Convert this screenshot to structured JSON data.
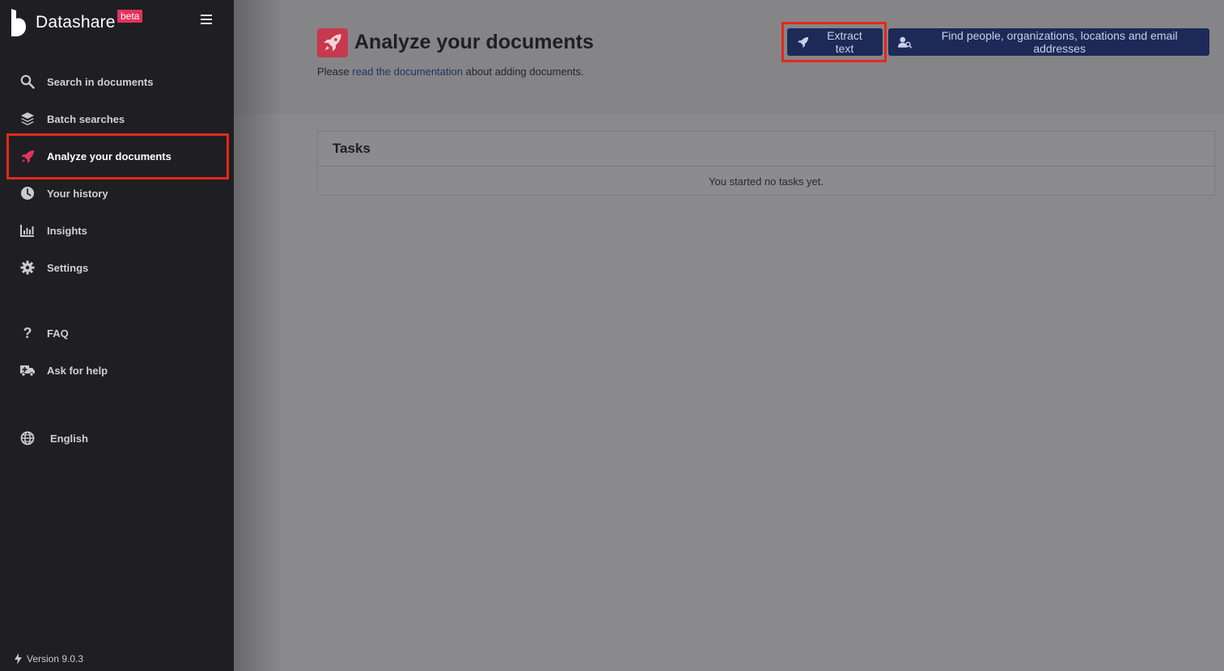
{
  "sidebar": {
    "brand_name": "Datashare",
    "brand_badge": "beta",
    "items": [
      {
        "label": "Search in documents",
        "icon": "search-icon"
      },
      {
        "label": "Batch searches",
        "icon": "layers-icon"
      },
      {
        "label": "Analyze your documents",
        "icon": "rocket-icon",
        "active": true
      },
      {
        "label": "Your history",
        "icon": "clock-icon"
      },
      {
        "label": "Insights",
        "icon": "chart-icon"
      },
      {
        "label": "Settings",
        "icon": "gear-icon"
      },
      {
        "label": "FAQ",
        "icon": "question-icon"
      },
      {
        "label": "Ask for help",
        "icon": "ambulance-icon"
      },
      {
        "label": "English",
        "icon": "globe-icon"
      }
    ],
    "version": "Version 9.0.3"
  },
  "header": {
    "title": "Analyze your documents",
    "subtitle_before": "Please ",
    "subtitle_link": "read the documentation",
    "subtitle_after": " about adding documents.",
    "extract_button": "Extract text",
    "find_button": "Find people, organizations, locations and email addresses"
  },
  "tasks": {
    "title": "Tasks",
    "empty_text": "You started no tasks yet."
  },
  "colors": {
    "sidebar_bg": "#1f1f23",
    "accent": "#e6315a",
    "button_bg": "#1d2a58",
    "highlight": "#e5281b"
  }
}
